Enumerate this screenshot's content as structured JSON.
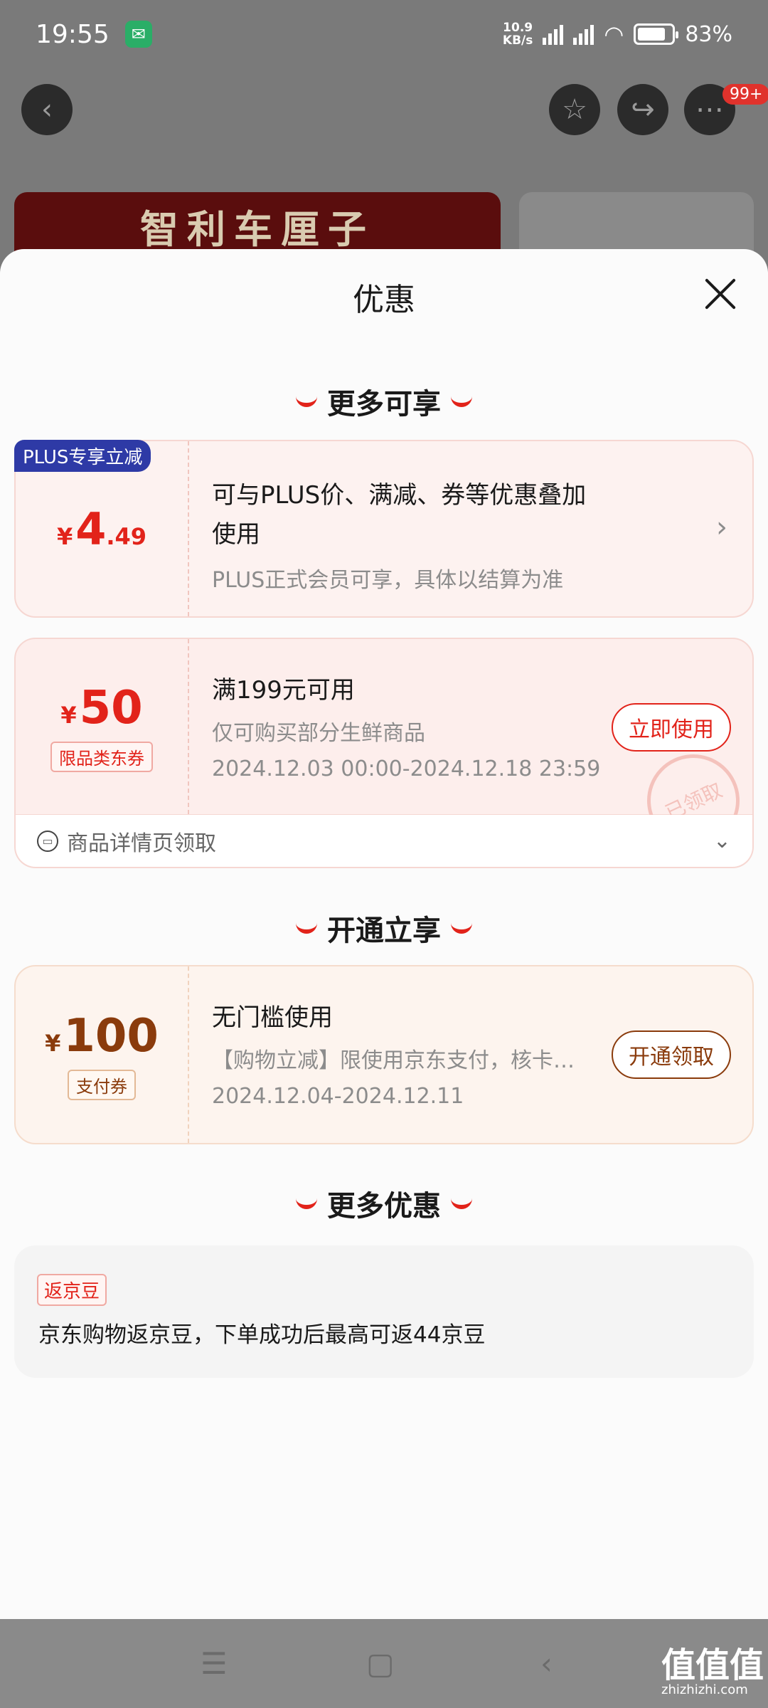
{
  "status_bar": {
    "time": "19:55",
    "net_speed": "10.9",
    "net_unit": "KB/s",
    "battery": "83%"
  },
  "header": {
    "badge": "99+"
  },
  "background": {
    "banner_text": "智利车厘子"
  },
  "sheet": {
    "title": "优惠",
    "sections": {
      "enjoy_more": "更多可享",
      "open_enjoy": "开通立享",
      "more_offers": "更多优惠"
    }
  },
  "plus_card": {
    "tag": "PLUS专享立减",
    "currency": "¥",
    "price_int": "4",
    "price_dec": ".49",
    "line1": "可与PLUS价、满减、券等优惠叠加",
    "line2": "使用",
    "line3": "PLUS正式会员可享，具体以结算为准"
  },
  "coupon_card": {
    "currency": "¥",
    "amount": "50",
    "type": "限品类东券",
    "title": "满199元可用",
    "scope": "仅可购买部分生鲜商品",
    "validity": "2024.12.03 00:00-2024.12.18 23:59",
    "button": "立即使用",
    "stamp": "已领取",
    "foot": "商品详情页领取"
  },
  "pay_card": {
    "currency": "¥",
    "amount": "100",
    "type": "支付券",
    "title": "无门槛使用",
    "desc": "【购物立减】限使用京东支付，核卡…",
    "validity": "2024.12.04-2024.12.11",
    "button": "开通领取"
  },
  "more": {
    "tag": "返京豆",
    "text": "京东购物返京豆，下单成功后最高可返44京豆"
  },
  "watermark": {
    "title": "值值值",
    "url": "zhizhizhi.com"
  },
  "colors": {
    "accent": "#e2231a",
    "plus_blue": "#2e3aa6"
  }
}
